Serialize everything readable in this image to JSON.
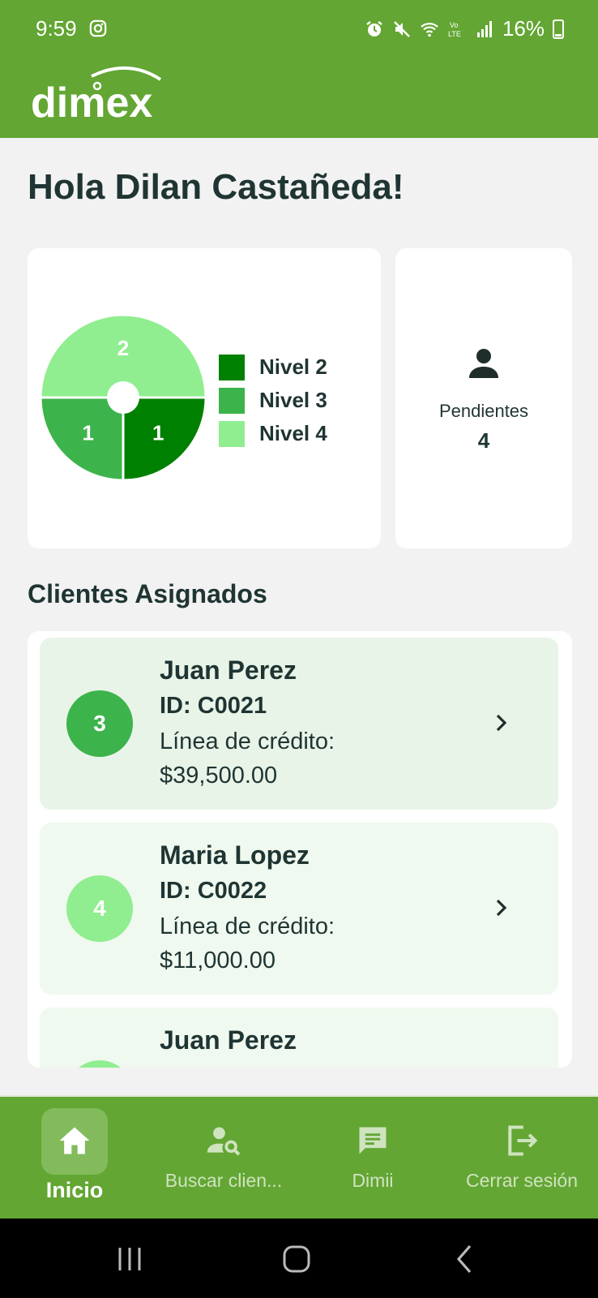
{
  "status_bar": {
    "time": "9:59",
    "battery": "16%",
    "icons": [
      "instagram-icon",
      "alarm-icon",
      "mute-icon",
      "wifi-icon",
      "volte-icon",
      "signal-icon",
      "battery-icon"
    ]
  },
  "app_bar": {
    "logo_text": "dimex"
  },
  "greeting": "Hola Dilan Castañeda!",
  "chart_data": {
    "type": "pie",
    "categories": [
      "Nivel 2",
      "Nivel 3",
      "Nivel 4"
    ],
    "values": [
      1,
      1,
      2
    ],
    "colors": [
      "#008000",
      "#3cb44b",
      "#90ee90"
    ]
  },
  "pending": {
    "label": "Pendientes",
    "count": "4",
    "icon": "person-icon"
  },
  "clients_section": {
    "title": "Clientes Asignados",
    "items": [
      {
        "level": "3",
        "name": "Juan Perez",
        "id": "ID: C0021",
        "credit_label": "Línea de crédito:",
        "amount": "$39,500.00",
        "avatar_color": "#3cb44b",
        "bg": "#e9f4e8"
      },
      {
        "level": "4",
        "name": "Maria Lopez",
        "id": "ID: C0022",
        "credit_label": "Línea de crédito:",
        "amount": "$11,000.00",
        "avatar_color": "#90ee90",
        "bg": "#f0f9ef"
      },
      {
        "level": "",
        "name": "Juan Perez",
        "id": "",
        "credit_label": "",
        "amount": "",
        "avatar_color": "#90ee90",
        "bg": "#f0f9ef"
      }
    ]
  },
  "bottom_nav": {
    "items": [
      {
        "label": "Inicio",
        "icon": "home-icon",
        "active": true
      },
      {
        "label": "Buscar clien...",
        "icon": "person-search-icon",
        "active": false
      },
      {
        "label": "Dimii",
        "icon": "chat-icon",
        "active": false
      },
      {
        "label": "Cerrar sesión",
        "icon": "logout-icon",
        "active": false
      }
    ]
  },
  "colors": {
    "primary": "#63a633",
    "text": "#1f3533",
    "background": "#f2f2f2"
  }
}
